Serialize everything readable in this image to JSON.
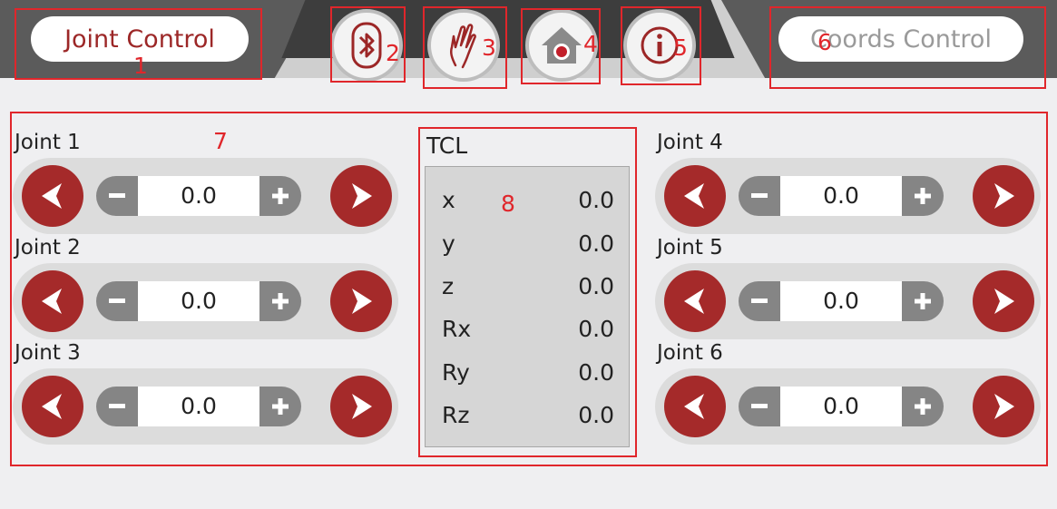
{
  "header": {
    "joint_mode_label": "Joint Control",
    "coords_mode_label": "Coords Control",
    "icons": [
      "bluetooth-icon",
      "hand-icon",
      "home-icon",
      "info-icon"
    ]
  },
  "annotations": [
    "1",
    "2",
    "3",
    "4",
    "5",
    "6",
    "7",
    "8"
  ],
  "joints": [
    {
      "label": "Joint 1",
      "value": "0.0"
    },
    {
      "label": "Joint 2",
      "value": "0.0"
    },
    {
      "label": "Joint 3",
      "value": "0.0"
    },
    {
      "label": "Joint 4",
      "value": "0.0"
    },
    {
      "label": "Joint 5",
      "value": "0.0"
    },
    {
      "label": "Joint 6",
      "value": "0.0"
    }
  ],
  "tcl": {
    "title": "TCL",
    "rows": [
      {
        "key": "x",
        "value": "0.0"
      },
      {
        "key": "y",
        "value": "0.0"
      },
      {
        "key": "z",
        "value": "0.0"
      },
      {
        "key": "Rx",
        "value": "0.0"
      },
      {
        "key": "Ry",
        "value": "0.0"
      },
      {
        "key": "Rz",
        "value": "0.0"
      }
    ]
  },
  "colors": {
    "accent_red": "#a52a2a",
    "annotation_red": "#e0262b",
    "header_dark": "#3d3d3d",
    "header_gray": "#5b5b5b",
    "background": "#efeff1",
    "stepper_gray": "#858585"
  }
}
